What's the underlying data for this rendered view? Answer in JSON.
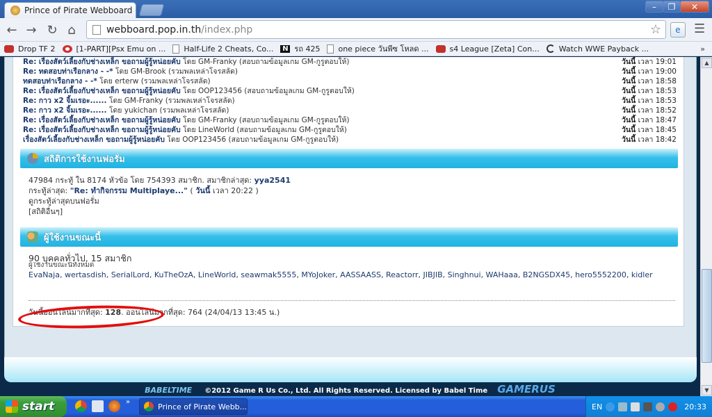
{
  "browser": {
    "tab_title": "Prince of Pirate Webboard - ",
    "tab_close": "×",
    "url_host": "webboard.pop.in.th",
    "url_path": "/index.php",
    "window_controls": {
      "minimize": "–",
      "maximize": "❐",
      "close": "✕"
    }
  },
  "bookmarks": [
    {
      "label": "Drop TF 2",
      "icon": "youtube-icon"
    },
    {
      "label": "[1-PART][Psx Emu on ...",
      "icon": "monster-icon"
    },
    {
      "label": "Half-Life 2 Cheats, Co...",
      "icon": "page-icon"
    },
    {
      "label": "รถ 425",
      "icon": "n-icon"
    },
    {
      "label": "one piece วันพีซ โหลด ...",
      "icon": "page-icon"
    },
    {
      "label": "s4 League [Zeta] Con...",
      "icon": "youtube-icon"
    },
    {
      "label": "Watch WWE Payback ...",
      "icon": "c-icon"
    }
  ],
  "bookmarks_more": "»",
  "recent_posts": [
    {
      "re": "Re:",
      "title": "เรื่องสัตว์เลี้ยงกับช่างเหล็ก ขอถามผู้รู้หน่อยคับ",
      "by": "โดย GM-Franky",
      "cat": "(สอบถามข้อมูลเกม GM-กูรูตอบให้)",
      "day": "วันนี้",
      "time": "เวลา 19:01"
    },
    {
      "re": "Re:",
      "title": "ทดสอบท่าเรือกลาง - -*",
      "by": "โดย GM-Brook",
      "cat": "(รวมพลเหล่าโจรสลัด)",
      "day": "วันนี้",
      "time": "เวลา 19:00"
    },
    {
      "re": "",
      "title": "ทดสอบท่าเรือกลาง - -*",
      "by": "โดย erterw",
      "cat": "(รวมพลเหล่าโจรสลัด)",
      "day": "วันนี้",
      "time": "เวลา 18:58"
    },
    {
      "re": "Re:",
      "title": "เรื่องสัตว์เลี้ยงกับช่างเหล็ก ขอถามผู้รู้หน่อยคับ",
      "by": "โดย OOP123456",
      "cat": "(สอบถามข้อมูลเกม GM-กูรูตอบให้)",
      "day": "วันนี้",
      "time": "เวลา 18:53"
    },
    {
      "re": "Re:",
      "title": "กาว x2 จิ้มเรอะ......",
      "by": "โดย GM-Franky",
      "cat": "(รวมพลเหล่าโจรสลัด)",
      "day": "วันนี้",
      "time": "เวลา 18:53"
    },
    {
      "re": "Re:",
      "title": "กาว x2 จิ้มเรอะ......",
      "by": "โดย yukichan",
      "cat": "(รวมพลเหล่าโจรสลัด)",
      "day": "วันนี้",
      "time": "เวลา 18:52"
    },
    {
      "re": "Re:",
      "title": "เรื่องสัตว์เลี้ยงกับช่างเหล็ก ขอถามผู้รู้หน่อยคับ",
      "by": "โดย GM-Franky",
      "cat": "(สอบถามข้อมูลเกม GM-กูรูตอบให้)",
      "day": "วันนี้",
      "time": "เวลา 18:47"
    },
    {
      "re": "Re:",
      "title": "เรื่องสัตว์เลี้ยงกับช่างเหล็ก ขอถามผู้รู้หน่อยคับ",
      "by": "โดย LineWorld",
      "cat": "(สอบถามข้อมูลเกม GM-กูรูตอบให้)",
      "day": "วันนี้",
      "time": "เวลา 18:45"
    },
    {
      "re": "",
      "title": "เรื่องสัตว์เลี้ยงกับช่างเหล็ก ขอถามผู้รู้หน่อยคับ",
      "by": "โดย OOP123456",
      "cat": "(สอบถามข้อมูลเกม GM-กูรูตอบให้)",
      "day": "วันนี้",
      "time": "เวลา 18:42"
    }
  ],
  "stats_section": {
    "title": "สถิติการใช้งานฟอรั่ม",
    "line1_prefix": "47984 กระทู้ ใน 8174 หัวข้อ โดย 754393 สมาชิก. สมาชิกล่าสุด:",
    "latest_member": "yya2541",
    "line2_prefix": "กระทู้ล่าสุด:",
    "latest_post": "\"Re: ทำกิจกรรม Multiplaye...\"",
    "latest_post_open": "(",
    "latest_post_day": "วันนี้",
    "latest_post_time": "เวลา 20:22 )",
    "link_recent": "ดูกระทู้ล่าสุดบนฟอรั่ม",
    "link_more": "[สถิติอื่นๆ]"
  },
  "online_section": {
    "title": "ผู้ใช้งานขณะนี้",
    "count_text": "90 บุคคลทั่วไป, 15 สมาชิก",
    "sub_text": "ผู้ใช้งานขณะนี้ทั้งหมด",
    "members": "EvaNaja, wertasdish, SerialLord, KuTheOzA, LineWorld, seawmak5555, MYoJoker, AASSAASS, Reactorr, JIBJIB, Singhnui, WAHaaa, B2NGSDX45, hero5552200, kidler",
    "max_prefix": "วันนี้ออนไลน์มากที่สุด:",
    "max_today": "128",
    "max_suffix": ". ออนไลน์มากที่สุด: 764 (24/04/13 13:45 น.)"
  },
  "footer": {
    "babel": "BABELTIME",
    "copyright": "©2012 Game R Us Co., Ltd. All Rights Reserved. Licensed by Babel Time",
    "gamerus": "GAMERUS"
  },
  "taskbar": {
    "start_label": "start",
    "quicklaunch_more": "»",
    "task_title": "Prince of Pirate Webb...",
    "language": "EN",
    "clock": "20:33"
  },
  "colors": {
    "accent": "#20b3e2",
    "annotation": "#e20f0f",
    "taskbar": "#245edb"
  }
}
